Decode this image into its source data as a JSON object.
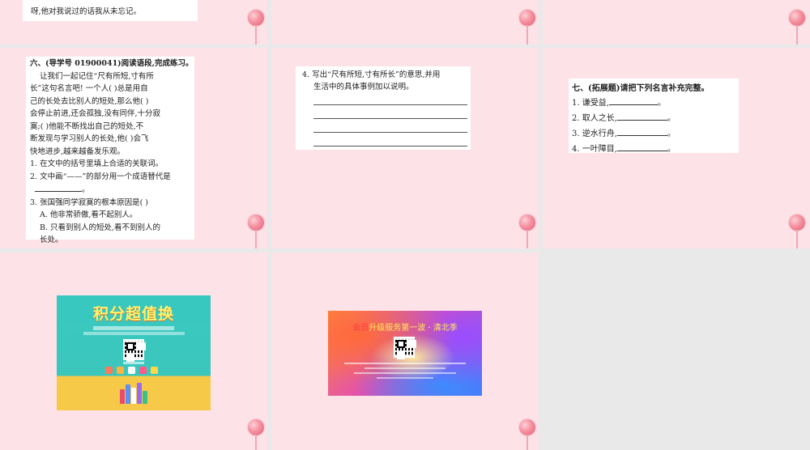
{
  "slides": {
    "top_left": {
      "lines": [
        "呀,他对我说过的话我从未忘记。"
      ]
    },
    "mid_left": {
      "heading": "六、(导学号 01900041)阅读语段,完成练习。",
      "passage": [
        "让我们一起记住“尺有所短,寸有所",
        "长”这句名言吧! 一个人(         )总是用自",
        "己的长处去比别人的短处,那么他(         )",
        "会停止前进,还会孤独,没有同伴,十分寂",
        "寞;(         )他能不断找出自己的短处,不",
        "断发现与学习别人的长处,他(      )会飞",
        "快地进步,越来越备发乐观。"
      ],
      "questions": [
        "1. 在文中的括号里填上合适的关联词。",
        "2. 文中画“——”的部分用一个成语替代是",
        "3. 张国强同学寂寞的根本原因是(      )"
      ],
      "q2_end": "。",
      "options": [
        "A. 他非常骄傲,看不起别人。",
        "B. 只看到别人的短处,看不到别人的",
        "长处。"
      ]
    },
    "mid_center": {
      "question_line1": "4. 写出“尺有所短,寸有所长”的意思,并用",
      "question_line2": "生活中的具体事例加以说明。"
    },
    "mid_right": {
      "heading": "七、(拓展题)请把下列名言补充完整。",
      "items": [
        {
          "text": "1. 谦受益,",
          "end": "。"
        },
        {
          "text": "2. 取人之长,",
          "end": "。"
        },
        {
          "text": "3. 逆水行舟,",
          "end": "。"
        },
        {
          "text": "4. 一叶障目,",
          "end": "。"
        }
      ]
    },
    "bottom_left": {
      "title": "积分超值换"
    },
    "bottom_center": {
      "title_a": "会员",
      "title_b": "升级服务第一波",
      "title_sep": "·",
      "title_c": "清北季"
    }
  },
  "colors": {
    "slide_bg": "#fde3e8",
    "gap_bg": "#e9e9e9",
    "card_bg": "#ffffff",
    "promo1_teal": "#38c8c0",
    "promo1_yellow": "#f7c948",
    "promo2_title": "#ffe95a"
  },
  "icons": [
    "lollipop-icon",
    "qr-code-icon",
    "books-icon"
  ]
}
